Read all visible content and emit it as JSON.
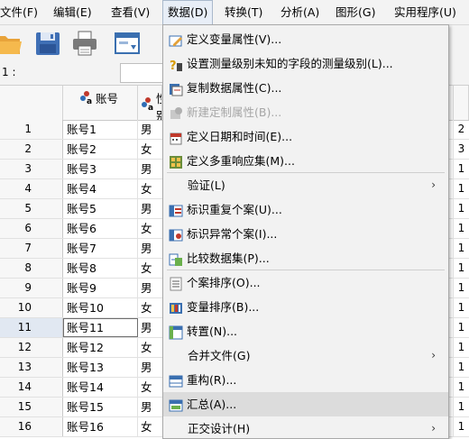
{
  "menubar": {
    "items": [
      {
        "label": "文件(F)"
      },
      {
        "label": "编辑(E)"
      },
      {
        "label": "查看(V)"
      },
      {
        "label": "数据(D)"
      },
      {
        "label": "转换(T)"
      },
      {
        "label": "分析(A)"
      },
      {
        "label": "图形(G)"
      },
      {
        "label": "实用程序(U)"
      }
    ]
  },
  "editrow": {
    "cell_ref": "1 :"
  },
  "columns": [
    {
      "label": "账号"
    },
    {
      "label": "性别"
    }
  ],
  "rows": [
    {
      "num": "1",
      "account": "账号1",
      "gender": "男",
      "extra": "2"
    },
    {
      "num": "2",
      "account": "账号2",
      "gender": "女",
      "extra": "3"
    },
    {
      "num": "3",
      "account": "账号3",
      "gender": "男",
      "extra": "1"
    },
    {
      "num": "4",
      "account": "账号4",
      "gender": "女",
      "extra": "1"
    },
    {
      "num": "5",
      "account": "账号5",
      "gender": "男",
      "extra": "1"
    },
    {
      "num": "6",
      "account": "账号6",
      "gender": "女",
      "extra": "1"
    },
    {
      "num": "7",
      "account": "账号7",
      "gender": "男",
      "extra": "1"
    },
    {
      "num": "8",
      "account": "账号8",
      "gender": "女",
      "extra": "1"
    },
    {
      "num": "9",
      "account": "账号9",
      "gender": "男",
      "extra": "1"
    },
    {
      "num": "10",
      "account": "账号10",
      "gender": "女",
      "extra": "1"
    },
    {
      "num": "11",
      "account": "账号11",
      "gender": "男",
      "extra": "1"
    },
    {
      "num": "12",
      "account": "账号12",
      "gender": "女",
      "extra": "1"
    },
    {
      "num": "13",
      "account": "账号13",
      "gender": "男",
      "extra": "1"
    },
    {
      "num": "14",
      "account": "账号14",
      "gender": "女",
      "extra": "1"
    },
    {
      "num": "15",
      "account": "账号15",
      "gender": "男",
      "extra": "1"
    },
    {
      "num": "16",
      "account": "账号16",
      "gender": "女",
      "extra": "1"
    }
  ],
  "dropdown": {
    "items": [
      {
        "label": "定义变量属性(V)...",
        "icon": "define-variable-icon"
      },
      {
        "label": "设置测量级别未知的字段的测量级别(L)...",
        "icon": "measure-level-icon"
      },
      {
        "label": "复制数据属性(C)...",
        "icon": "copy-properties-icon"
      },
      {
        "label": "新建定制属性(B)...",
        "icon": "custom-attribute-icon",
        "disabled": true
      },
      {
        "label": "定义日期和时间(E)...",
        "icon": "calendar-icon"
      },
      {
        "label": "定义多重响应集(M)...",
        "icon": "multiple-response-icon"
      },
      {
        "label": "验证(L)",
        "submenu": true
      },
      {
        "label": "标识重复个案(U)...",
        "icon": "duplicate-cases-icon"
      },
      {
        "label": "标识异常个案(I)...",
        "icon": "unusual-cases-icon"
      },
      {
        "label": "比较数据集(P)...",
        "icon": "compare-datasets-icon"
      },
      {
        "label": "个案排序(O)...",
        "icon": "sort-cases-icon"
      },
      {
        "label": "变量排序(B)...",
        "icon": "sort-variables-icon"
      },
      {
        "label": "转置(N)...",
        "icon": "transpose-icon"
      },
      {
        "label": "合并文件(G)",
        "submenu": true
      },
      {
        "label": "重构(R)...",
        "icon": "restructure-icon"
      },
      {
        "label": "汇总(A)...",
        "icon": "aggregate-icon",
        "hover": true
      },
      {
        "label": "正交设计(H)",
        "submenu": true
      }
    ],
    "submenu_arrow": "›"
  }
}
